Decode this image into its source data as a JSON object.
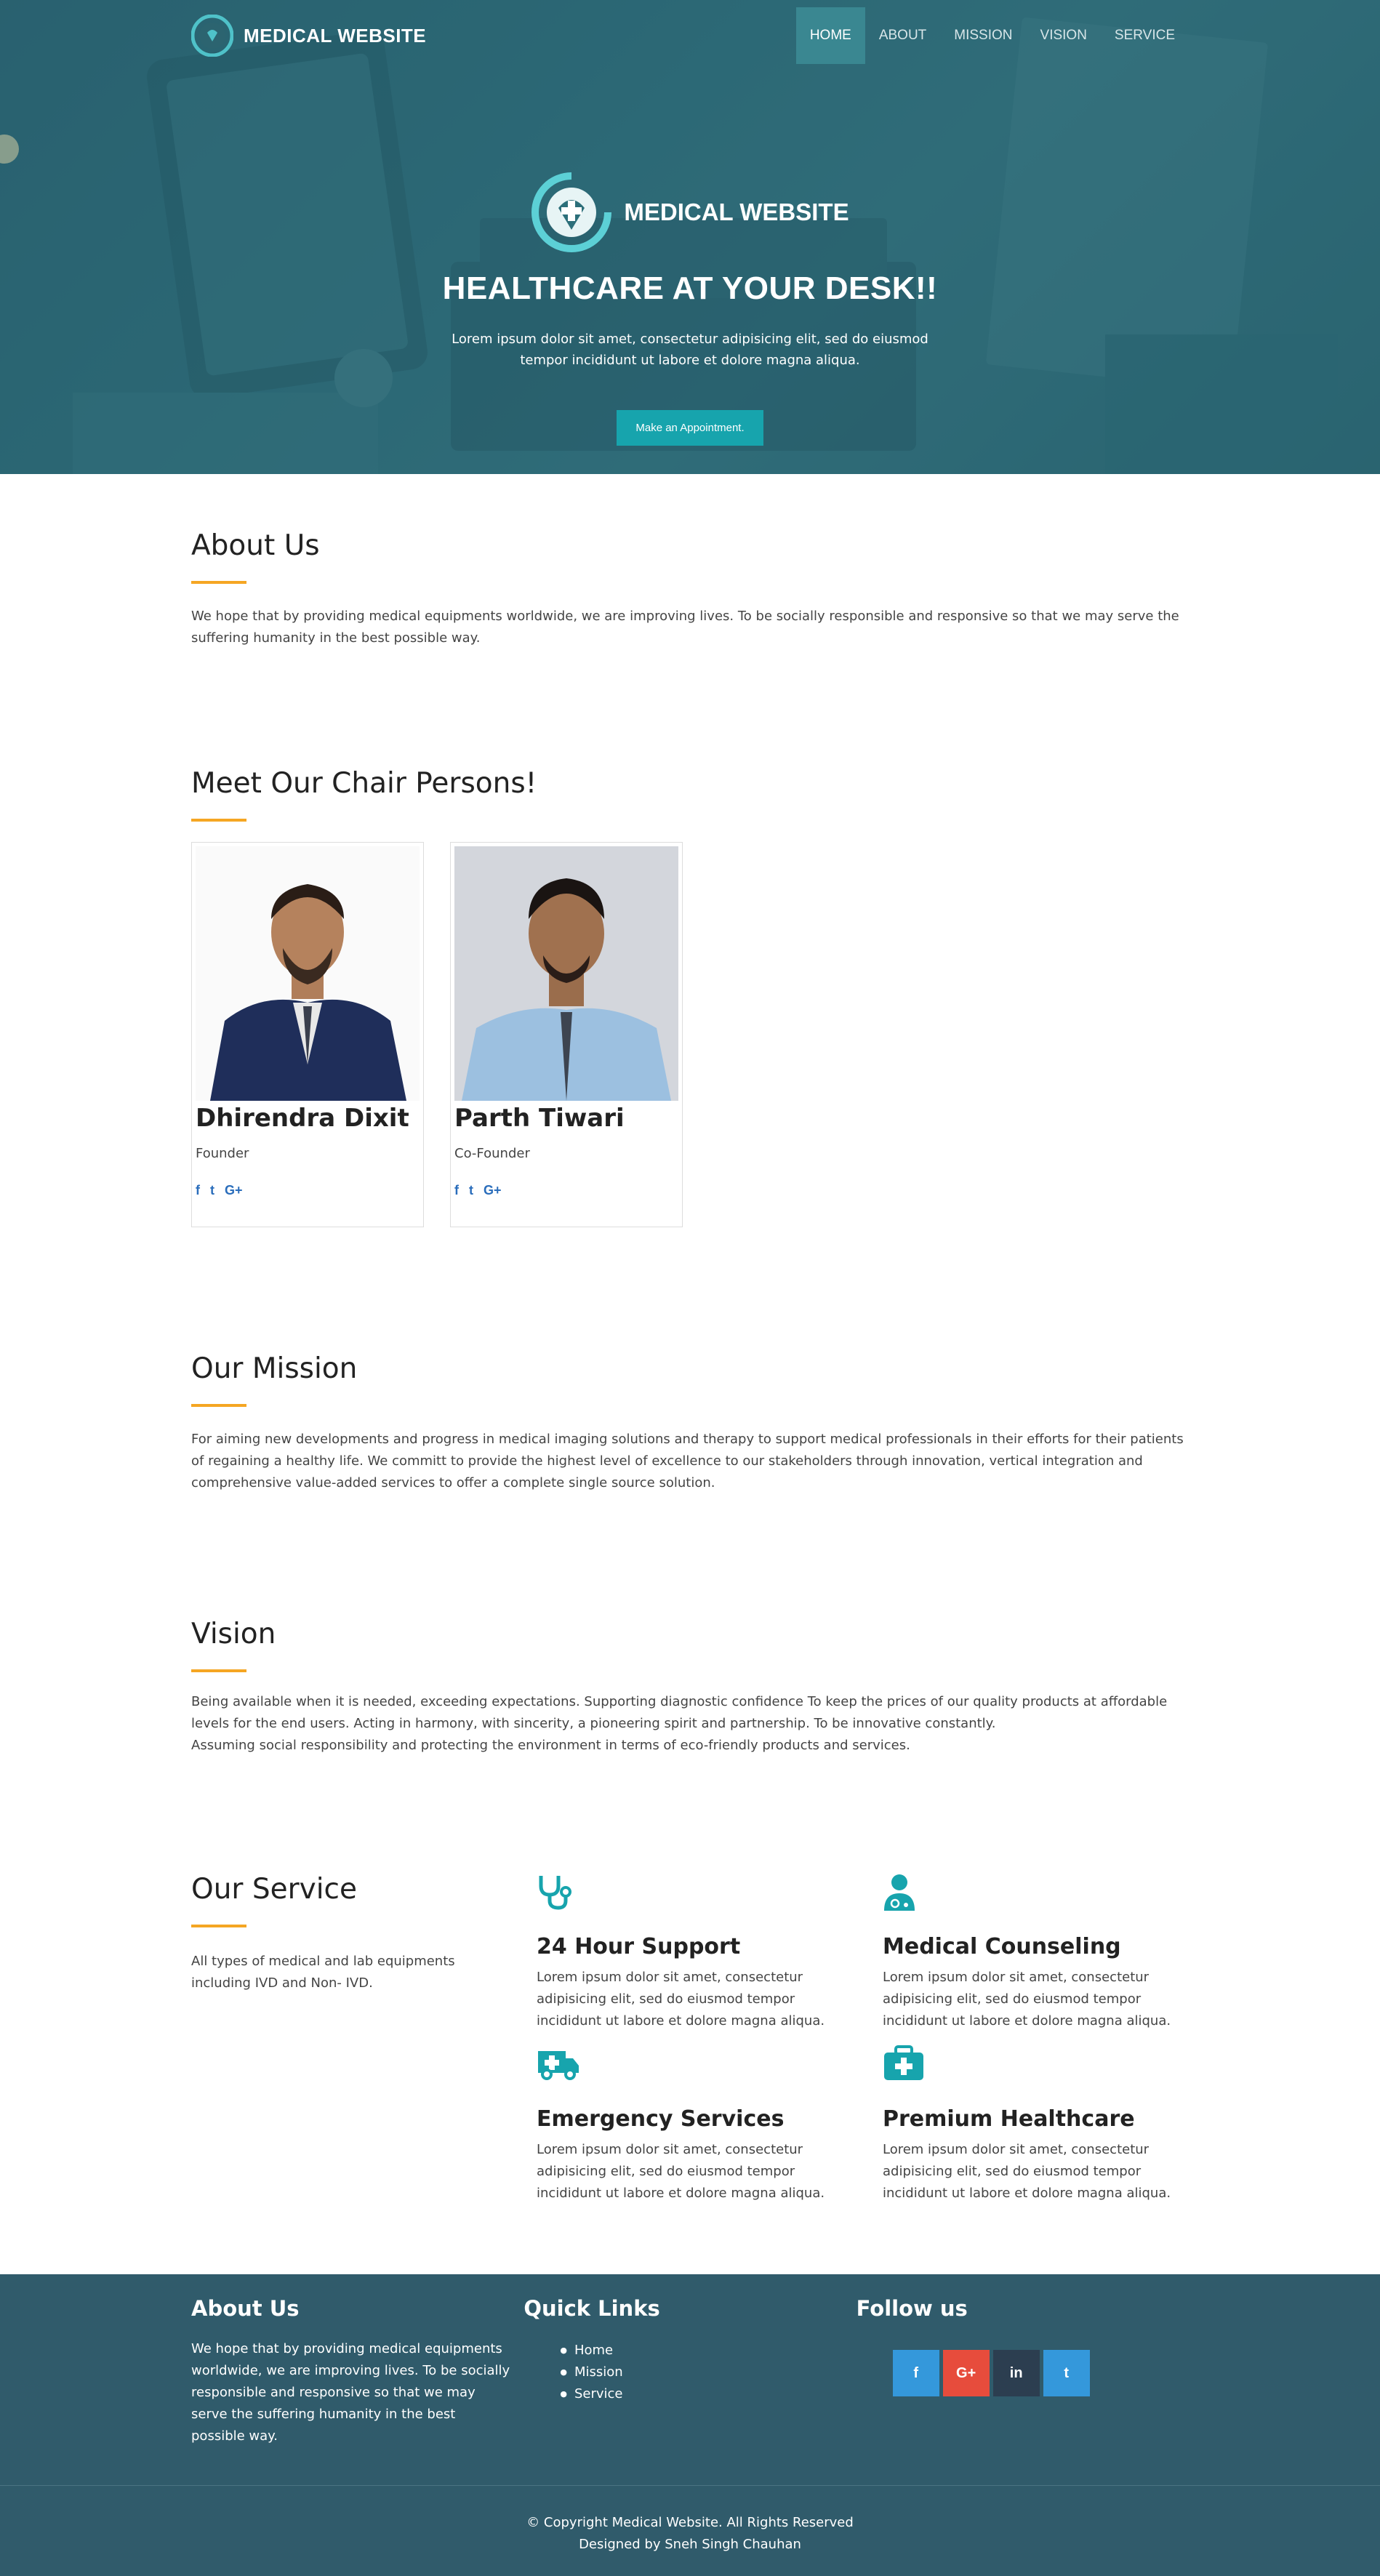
{
  "nav": {
    "brand": "MEDICAL WEBSITE",
    "items": [
      {
        "label": "HOME",
        "active": true
      },
      {
        "label": "ABOUT"
      },
      {
        "label": "MISSION"
      },
      {
        "label": "VISION"
      },
      {
        "label": "SERVICE"
      }
    ]
  },
  "hero": {
    "logo_text": "MEDICAL WEBSITE",
    "title": "HEALTHCARE AT YOUR DESK!!",
    "subtitle": "Lorem ipsum dolor sit amet, consectetur adipisicing elit, sed do eiusmod tempor incididunt ut labore et dolore magna aliqua.",
    "button": "Make an Appointment."
  },
  "about": {
    "title": "About Us",
    "text": "We hope that by providing medical equipments worldwide, we are improving lives. To be socially responsible and responsive so that we may serve the suffering humanity in the best possible way."
  },
  "chair": {
    "title": "Meet Our Chair Persons!",
    "people": [
      {
        "name": "Dhirendra Dixit",
        "role": "Founder",
        "socials": [
          "f",
          "t",
          "G+"
        ]
      },
      {
        "name": "Parth Tiwari",
        "role": "Co-Founder",
        "socials": [
          "f",
          "t",
          "G+"
        ]
      }
    ]
  },
  "mission": {
    "title": "Our Mission",
    "text": "For aiming new developments and progress in medical imaging solutions and therapy to support medical professionals in their efforts for their patients of regaining a healthy life. We committ to provide the highest level of excellence to our stakeholders through innovation, vertical integration and comprehensive value-added services to offer a complete single source solution."
  },
  "vision": {
    "title": "Vision",
    "line1": "Being available when it is needed, exceeding expectations. Supporting diagnostic confidence To keep the prices of our quality products at affordable levels for the end users. Acting in harmony, with sincerity, a pioneering spirit and partnership. To be innovative constantly.",
    "line2": "Assuming social responsibility and protecting the environment in terms of eco-friendly products and services."
  },
  "service": {
    "title": "Our Service",
    "text": "All types of medical and lab equipments including IVD and Non- IVD.",
    "items": [
      {
        "icon": "stethoscope-icon",
        "title": "24 Hour Support",
        "text": "Lorem ipsum dolor sit amet, consectetur adipisicing elit, sed do eiusmod tempor incididunt ut labore et dolore magna aliqua."
      },
      {
        "icon": "doctor-icon",
        "title": "Medical Counseling",
        "text": "Lorem ipsum dolor sit amet, consectetur adipisicing elit, sed do eiusmod tempor incididunt ut labore et dolore magna aliqua."
      },
      {
        "icon": "ambulance-icon",
        "title": "Emergency Services",
        "text": "Lorem ipsum dolor sit amet, consectetur adipisicing elit, sed do eiusmod tempor incididunt ut labore et dolore magna aliqua."
      },
      {
        "icon": "medical-kit-icon",
        "title": "Premium Healthcare",
        "text": "Lorem ipsum dolor sit amet, consectetur adipisicing elit, sed do eiusmod tempor incididunt ut labore et dolore magna aliqua."
      }
    ]
  },
  "footer": {
    "about_title": "About Us",
    "about_text": "We hope that by providing medical equipments worldwide, we are improving lives. To be socially responsible and responsive so that we may serve the suffering humanity in the best possible way.",
    "links_title": "Quick Links",
    "links": [
      "Home",
      "Mission",
      "Service"
    ],
    "follow_title": "Follow us",
    "follow": [
      {
        "label": "f",
        "color": "#3498db"
      },
      {
        "label": "G+",
        "color": "#e74c3c"
      },
      {
        "label": "in",
        "color": "#2c3e50"
      },
      {
        "label": "t",
        "color": "#3498db"
      }
    ],
    "copyright": "© Copyright Medical Website. All Rights Reserved",
    "designed_by": "Designed by Sneh Singh Chauhan"
  },
  "colors": {
    "accent": "#17a4ad",
    "underline": "#f5a623",
    "footer_bg": "#305b6b"
  }
}
